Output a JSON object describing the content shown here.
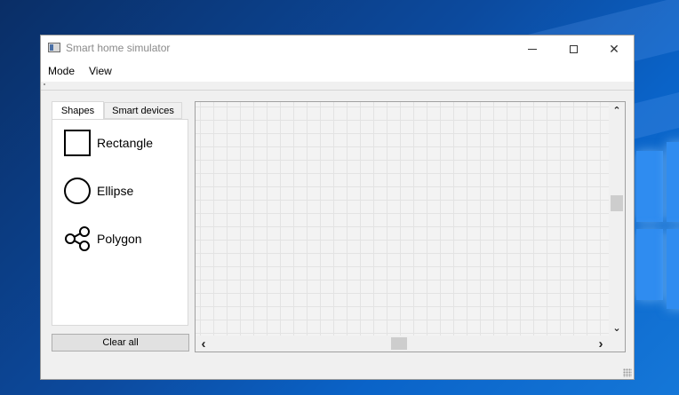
{
  "window": {
    "title": "Smart home simulator",
    "close_glyph": "✕"
  },
  "menu": {
    "items": [
      {
        "label": "Mode"
      },
      {
        "label": "View"
      }
    ]
  },
  "tabs": [
    {
      "label": "Shapes",
      "active": true
    },
    {
      "label": "Smart devices",
      "active": false
    }
  ],
  "shapes": [
    {
      "label": "Rectangle",
      "icon": "rectangle-icon"
    },
    {
      "label": "Ellipse",
      "icon": "ellipse-icon"
    },
    {
      "label": "Polygon",
      "icon": "polygon-icon"
    }
  ],
  "actions": {
    "clear_all_label": "Clear all"
  },
  "scroll": {
    "up": "⌃",
    "down": "⌄",
    "left": "‹",
    "right": "›"
  },
  "colors": {
    "desktop_blue": "#0c4a9e",
    "window_bg": "#f0f0f0",
    "grid_line": "#e3e3e3"
  }
}
